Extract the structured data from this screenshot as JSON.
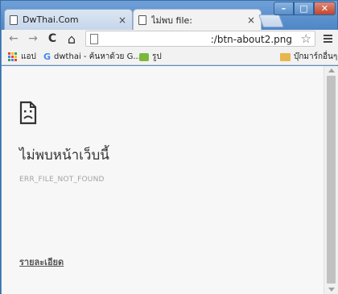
{
  "tabs": [
    {
      "title": "DwThai.Com",
      "close": "×",
      "icon": "document-icon"
    },
    {
      "title": "ไม่พบ file:",
      "close": "×",
      "icon": "document-icon"
    }
  ],
  "window_controls": {
    "minimize": "–",
    "maximize": "□",
    "close": "✕"
  },
  "toolbar": {
    "back": "←",
    "forward": "→",
    "reload": "C",
    "home": "⌂",
    "url": ":/btn-about2.png",
    "star": "☆"
  },
  "bookmarks": {
    "apps_label": "แอป",
    "item1_label": "dwthai - ค้นหาด้วย G...",
    "item2_label": "รูป",
    "other_label": "บุ๊กมาร์กอื่นๆ"
  },
  "error_page": {
    "title": "ไม่พบหน้าเว็บนี้",
    "code": "ERR_FILE_NOT_FOUND",
    "details_link": "รายละเอียด",
    "icon": "sad-document-icon"
  },
  "colors": {
    "frame": "#5a8ec9",
    "page_background": "#f7f7f7",
    "title_text": "#333333",
    "code_text": "#a3a3a3"
  }
}
